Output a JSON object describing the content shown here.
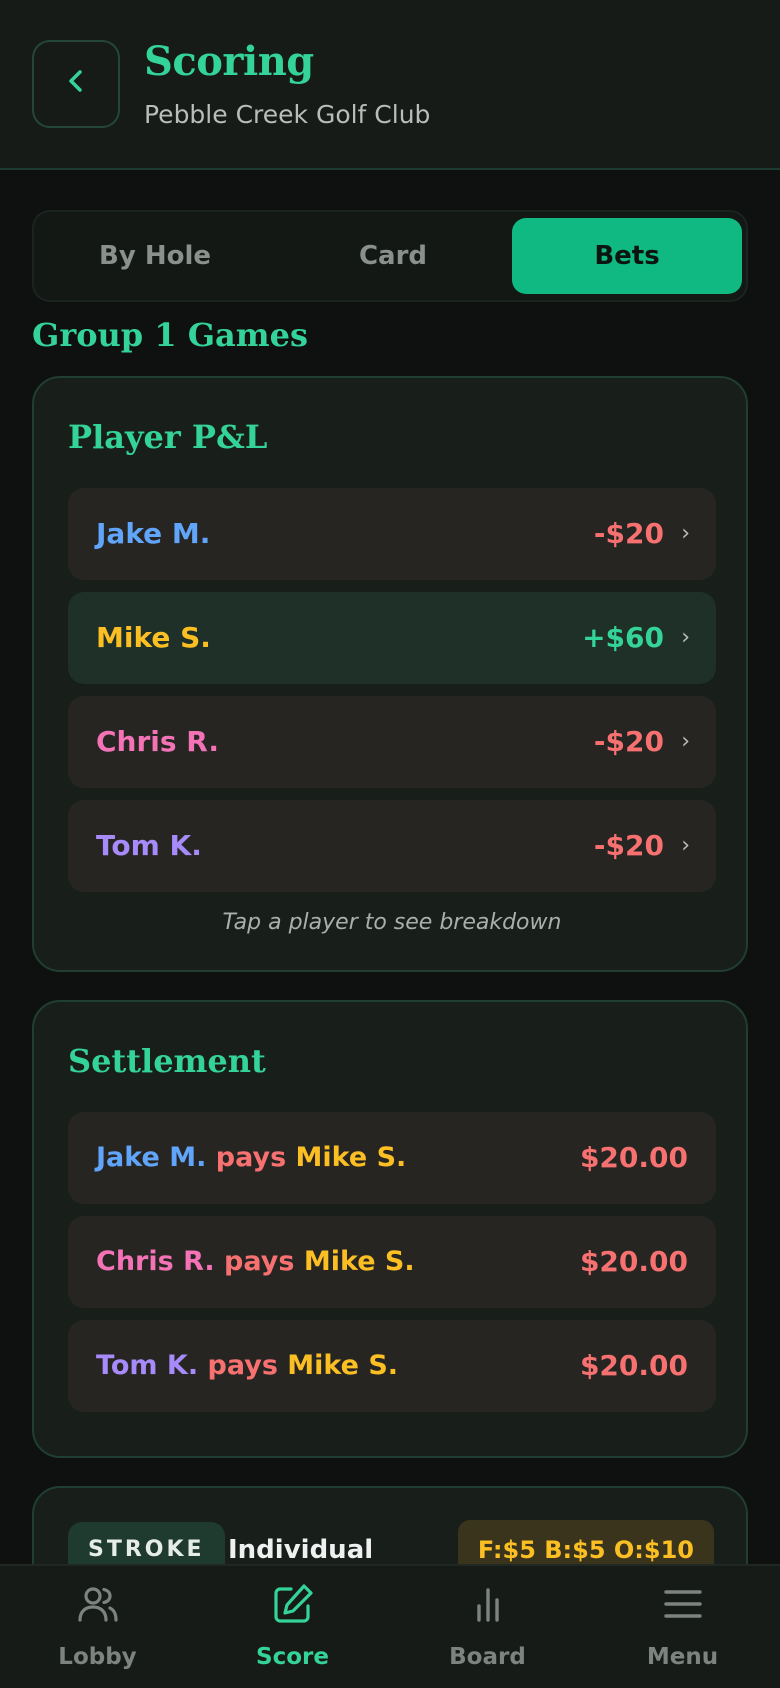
{
  "header": {
    "title": "Scoring",
    "subtitle": "Pebble Creek Golf Club",
    "back_icon": "chevron-left-icon"
  },
  "tabs": [
    {
      "label": "By Hole",
      "active": false
    },
    {
      "label": "Card",
      "active": false
    },
    {
      "label": "Bets",
      "active": true
    }
  ],
  "group_title": "Group 1 Games",
  "pl": {
    "title": "Player P&L",
    "hint": "Tap a player to see breakdown",
    "players": [
      {
        "name": "Jake M.",
        "amount": "-$20",
        "color": "#60a5fa"
      },
      {
        "name": "Mike S.",
        "amount": "+$60",
        "color": "#fbbf24"
      },
      {
        "name": "Chris R.",
        "amount": "-$20",
        "color": "#f472b6"
      },
      {
        "name": "Tom K.",
        "amount": "-$20",
        "color": "#a78bfa"
      }
    ]
  },
  "settlement": {
    "title": "Settlement",
    "items": [
      {
        "payer": "Jake M.",
        "verb": "pays",
        "payee": "Mike S.",
        "amount": "$20.00"
      },
      {
        "payer": "Chris R.",
        "verb": "pays",
        "payee": "Mike S.",
        "amount": "$20.00"
      },
      {
        "payer": "Tom K.",
        "verb": "pays",
        "payee": "Mike S.",
        "amount": "$20.00"
      }
    ]
  },
  "game": {
    "badge": "STROKE",
    "type": "Individual",
    "stakes": "F:$5 B:$5 O:$10"
  },
  "nav": [
    {
      "label": "Lobby",
      "icon": "users-icon",
      "active": false
    },
    {
      "label": "Score",
      "icon": "edit-icon",
      "active": true
    },
    {
      "label": "Board",
      "icon": "bar-chart-icon",
      "active": false
    },
    {
      "label": "Menu",
      "icon": "menu-icon",
      "active": false
    }
  ],
  "colors": {
    "accent": "#34d399",
    "active_tab": "#10b981",
    "negative": "#f87171",
    "positive": "#34d399",
    "stakes": "#fbbf24"
  }
}
